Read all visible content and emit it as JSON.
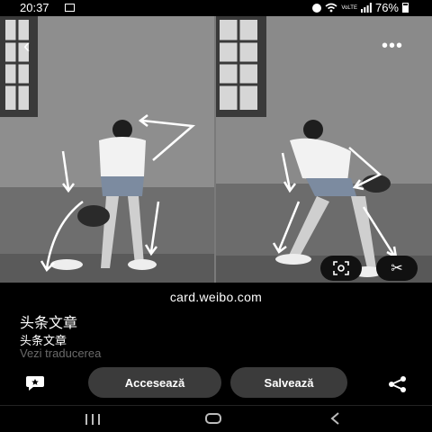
{
  "status_bar": {
    "time": "20:37",
    "battery": "76%",
    "icons": [
      "image-icon",
      "dnd-icon",
      "wifi-icon",
      "volte-icon",
      "signal-icon",
      "battery-icon"
    ]
  },
  "viewer": {
    "icons": {
      "back": "back-arrow-icon",
      "more": "more-options-icon"
    }
  },
  "result": {
    "source": "card.weibo.com",
    "title": "头条文章",
    "subtitle": "头条文章",
    "translate_link": "Vezi traducerea"
  },
  "actions": {
    "visit_label": "Accesează",
    "save_label": "Salvează"
  },
  "colors": {
    "background": "#000000",
    "button": "#3b3b3b",
    "muted_text": "#6a6a6a"
  }
}
